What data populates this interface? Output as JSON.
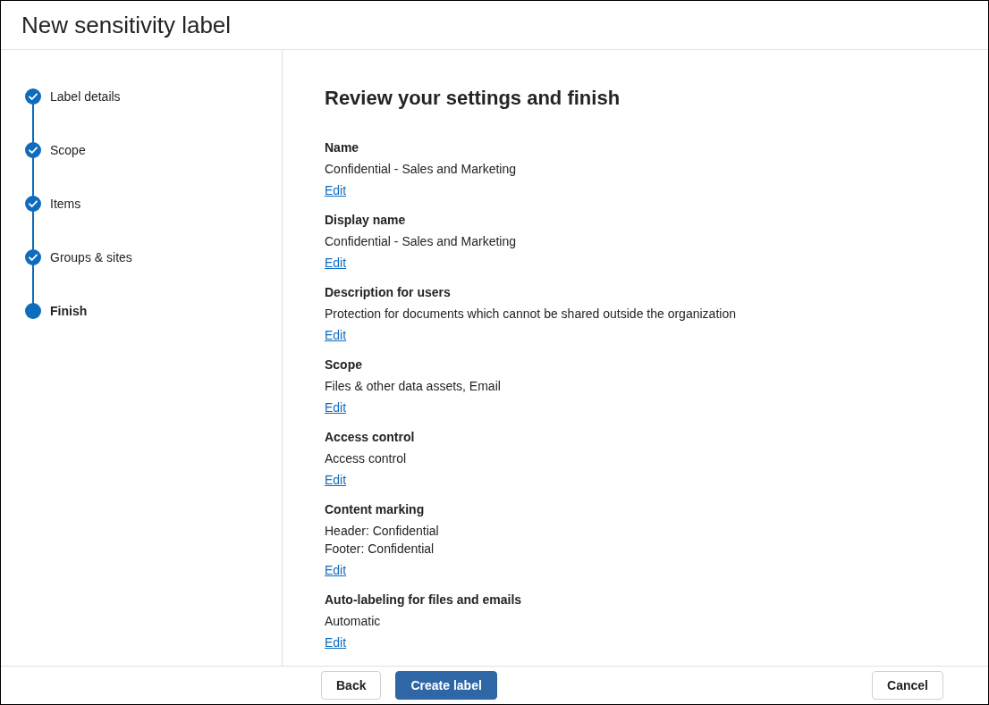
{
  "window": {
    "title": "New sensitivity label"
  },
  "steps": [
    {
      "label": "Label details",
      "completed": true,
      "selected": false
    },
    {
      "label": "Scope",
      "completed": true,
      "selected": false
    },
    {
      "label": "Items",
      "completed": true,
      "selected": false
    },
    {
      "label": "Groups & sites",
      "completed": true,
      "selected": false
    },
    {
      "label": "Finish",
      "completed": false,
      "selected": true
    }
  ],
  "review": {
    "heading": "Review your settings and finish",
    "sections": [
      {
        "label": "Name",
        "values": [
          "Confidential - Sales and Marketing"
        ],
        "link": "Edit"
      },
      {
        "label": "Display name",
        "values": [
          "Confidential - Sales and Marketing"
        ],
        "link": "Edit"
      },
      {
        "label": "Description for users",
        "values": [
          "Protection for documents which cannot be shared outside the organization"
        ],
        "link": "Edit"
      },
      {
        "label": "Scope",
        "values": [
          "Files & other data assets, Email"
        ],
        "link": "Edit"
      },
      {
        "label": "Access control",
        "values": [
          "Access control"
        ],
        "link": "Edit"
      },
      {
        "label": "Content marking",
        "values": [
          "Header: Confidential",
          "Footer: Confidential"
        ],
        "link": "Edit"
      },
      {
        "label": "Auto-labeling for files and emails",
        "values": [
          "Automatic"
        ],
        "link": "Edit"
      }
    ]
  },
  "footer": {
    "buttons": [
      {
        "label": "Back",
        "kind": "secondary"
      },
      {
        "label": "Create label",
        "kind": "primary"
      },
      {
        "label": "Cancel",
        "kind": "cancel"
      }
    ]
  }
}
